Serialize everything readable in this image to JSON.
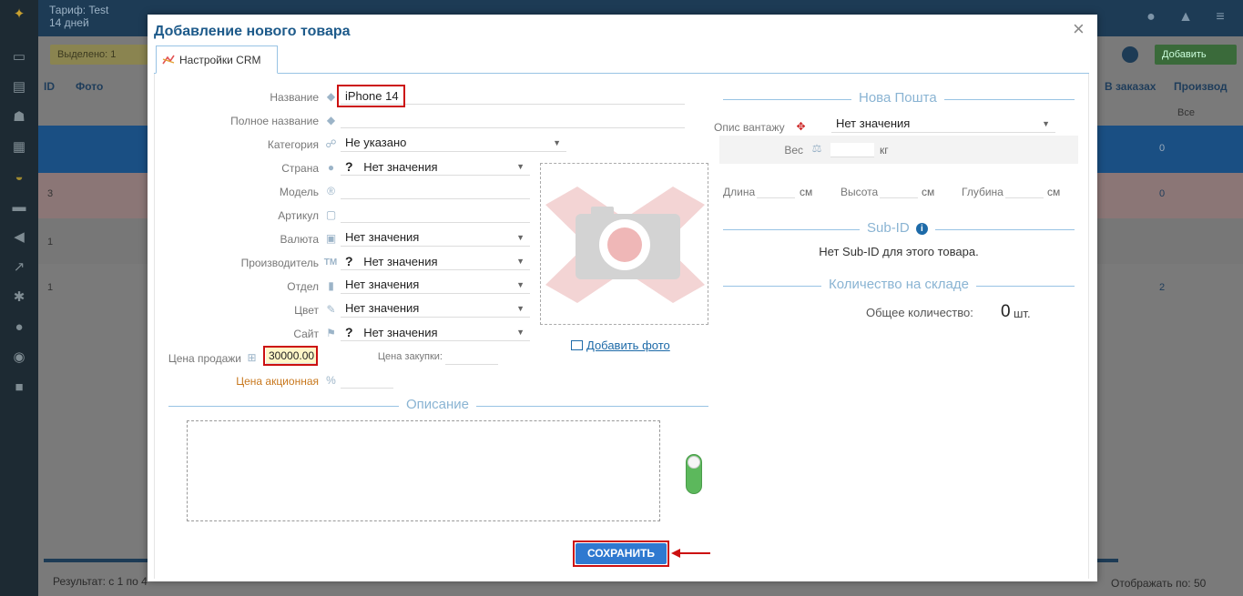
{
  "background": {
    "tariff_line1": "Тариф: Test",
    "tariff_line2": "14 дней",
    "selected_label": "Выделено: 1",
    "add_label": "Добавить",
    "col_id": "ID",
    "col_photo": "Фото",
    "col_orders": "В заказах",
    "col_producer": "Производ",
    "filter_all": "Все",
    "row_values": [
      "0",
      "0",
      "2"
    ],
    "row_numbers": [
      "3",
      "1",
      "1"
    ],
    "footer_result": "Результат: с 1 по 4",
    "footer_per_page": "Отображать по: 50"
  },
  "modal": {
    "title": "Добавление нового товара",
    "close_label": "×",
    "tab_label": "Настройки CRM",
    "fields": {
      "name_label": "Название",
      "name_value": "iPhone  14",
      "full_name_label": "Полное название",
      "category_label": "Категория",
      "category_value": "Не указано",
      "country_label": "Страна",
      "country_value": "Нет значения",
      "model_label": "Модель",
      "article_label": "Артикул",
      "currency_label": "Валюта",
      "currency_value": "Нет значения",
      "producer_label": "Производитель",
      "producer_value": "Нет значения",
      "department_label": "Отдел",
      "department_value": "Нет значения",
      "color_label": "Цвет",
      "color_value": "Нет значения",
      "site_label": "Сайт",
      "site_value": "Нет значения",
      "sale_price_label": "Цена продажи",
      "sale_price_value": "30000.00",
      "purchase_price_label": "Цена закупки:",
      "promo_price_label": "Цена акционная",
      "question_mark": "?"
    },
    "add_photo_label": "Добавить фото",
    "description_title": "Описание",
    "save_label": "СОХРАНИТЬ",
    "nova_poshta": {
      "title": "Нова Пошта",
      "cargo_label": "Опис вантажу",
      "cargo_value": "Нет значения",
      "weight_label": "Вес",
      "weight_unit": "кг",
      "length_label": "Длина",
      "width_label": "Высота",
      "depth_label": "Глубина",
      "cm_unit": "см"
    },
    "sub_id": {
      "title": "Sub-ID",
      "empty_text": "Нет Sub-ID для этого товара."
    },
    "stock": {
      "title": "Количество на складе",
      "total_label": "Общее количество:",
      "total_value": "0",
      "unit": "шт."
    }
  },
  "colors": {
    "accent": "#1d5a8a",
    "save_button": "#2f79d0",
    "highlight_border": "#cc1010",
    "toggle_on": "#5cb85c",
    "promo_label": "#c8781e"
  }
}
